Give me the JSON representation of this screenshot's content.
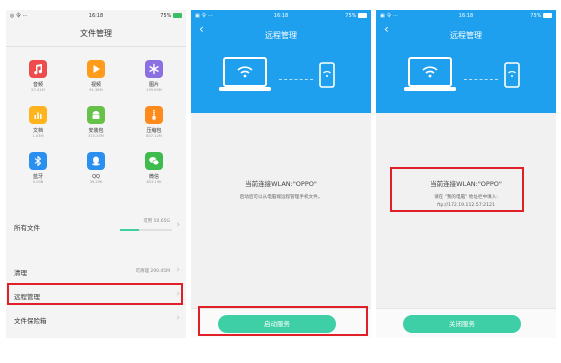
{
  "panel1": {
    "status": {
      "left": "◎ 令 ···",
      "time": "16:18",
      "battery": "75%"
    },
    "title": "文件管理",
    "categories": [
      {
        "name": "音频",
        "size": "57.41M",
        "icon": "music-icon",
        "color": "#ee4c4c"
      },
      {
        "name": "视频",
        "size": "91.38M",
        "icon": "video-play-icon",
        "color": "#ff9c1c"
      },
      {
        "name": "图片",
        "size": "159.09M",
        "icon": "picture-icon",
        "color": "#8c6fe0"
      },
      {
        "name": "文档",
        "size": "1.53M",
        "icon": "document-icon",
        "color": "#ffb31c"
      },
      {
        "name": "安装包",
        "size": "315.33M",
        "icon": "android-icon",
        "color": "#68c24a"
      },
      {
        "name": "压缩包",
        "size": "807.12M",
        "icon": "zip-icon",
        "color": "#ff8a1c"
      },
      {
        "name": "蓝牙",
        "size": "0.00B",
        "icon": "bluetooth-icon",
        "color": "#2b8ff0"
      },
      {
        "name": "QQ",
        "size": "39.29K",
        "icon": "qq-icon",
        "color": "#2b8ff0"
      },
      {
        "name": "微信",
        "size": "853.19K",
        "icon": "wechat-icon",
        "color": "#3dbb4c"
      }
    ],
    "all_files": {
      "label": "所有文件",
      "available": "可用 50.65G",
      "used_fraction": 0.36
    },
    "clean": {
      "label": "清理",
      "value": "可清理 290.45M"
    },
    "remote": {
      "label": "远程管理"
    },
    "safe": {
      "label": "文件保险箱"
    }
  },
  "panel2": {
    "status": {
      "left": "▣ 令 ···",
      "time": "16:18",
      "battery": "75%"
    },
    "title": "远程管理",
    "connected": "当前连接WLAN:\"OPPO\"",
    "hint": "启动后可以从电脑端远程管理手机文件。",
    "button": "启动服务"
  },
  "panel3": {
    "status": {
      "left": "▣ 令 ···",
      "time": "16:18",
      "battery": "75%"
    },
    "title": "远程管理",
    "connected": "当前连接WLAN:\"OPPO\"",
    "hint_line1": "请在 \"我的电脑\" 地址栏中填入:",
    "hint_line2": "ftp://172.19.112.57:2121",
    "button": "关闭服务"
  },
  "colors": {
    "accent_blue": "#1ea0ee",
    "button_green": "#3ecfa6",
    "highlight_red": "#e01f26"
  }
}
